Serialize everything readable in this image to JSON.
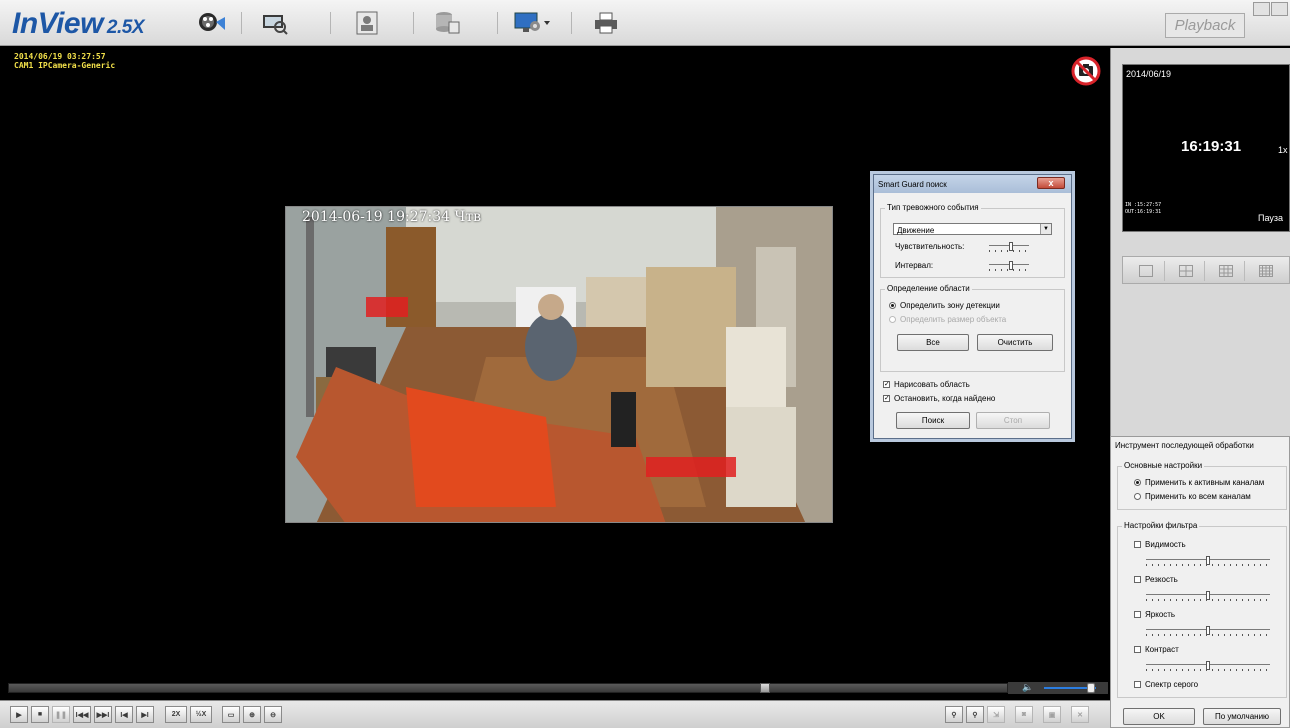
{
  "app": {
    "logo": "InView",
    "version": "2.5X",
    "playback_label": "Playback"
  },
  "toolbar": {
    "icons": [
      "camera-reel-icon",
      "video-search-icon",
      "user-id-icon",
      "database-export-icon",
      "monitor-settings-icon",
      "printer-icon"
    ]
  },
  "video": {
    "osd_datetime": "2014/06/19 03:27:57",
    "osd_camera": "CAM1 IPCamera-Generic",
    "camera_timestamp": "2014-06-19 19:27:34 Чтв"
  },
  "smart_guard": {
    "title": "Smart Guard поиск",
    "close_label": "x",
    "event_type_group": "Тип тревожного события",
    "event_type_value": "Движение",
    "sensitivity_label": "Чувствительность:",
    "sensitivity": 0.55,
    "interval_label": "Интервал:",
    "interval": 0.55,
    "region_group": "Определение области",
    "region_opt_zone": "Определить зону детекции",
    "region_opt_size": "Определить размер объекта",
    "all_button": "Все",
    "clear_button": "Очистить",
    "draw_region_label": "Нарисовать область",
    "stop_when_found_label": "Остановить, когда найдено",
    "search_button": "Поиск",
    "stop_button": "Стоп"
  },
  "preview": {
    "date": "2014/06/19",
    "time": "16:19:31",
    "speed": "1x",
    "in_time": "IN :15:27:57",
    "out_time": "OUT:16:19:31",
    "status": "Пауза"
  },
  "post_processing": {
    "title": "Инструмент последующей обработки",
    "basic_group": "Основные настройки",
    "apply_active": "Применить к активным каналам",
    "apply_all": "Применить ко всем каналам",
    "filter_group": "Настройки фильтра",
    "visibility_label": "Видимость",
    "sharpness_label": "Резкость",
    "brightness_label": "Яркость",
    "contrast_label": "Контраст",
    "grayscale_label": "Спектр серого",
    "ok_button": "OK",
    "default_button": "По умолчанию",
    "slider_level": 0.5
  },
  "bottom": {
    "progress": 0.76,
    "volume": 0.9,
    "speed_2x": "2X",
    "speed_half": "½X"
  },
  "colors": {
    "logo_blue": "#1d57a6",
    "osd_yellow": "#f2e04a",
    "detect_red": "#e02020"
  }
}
